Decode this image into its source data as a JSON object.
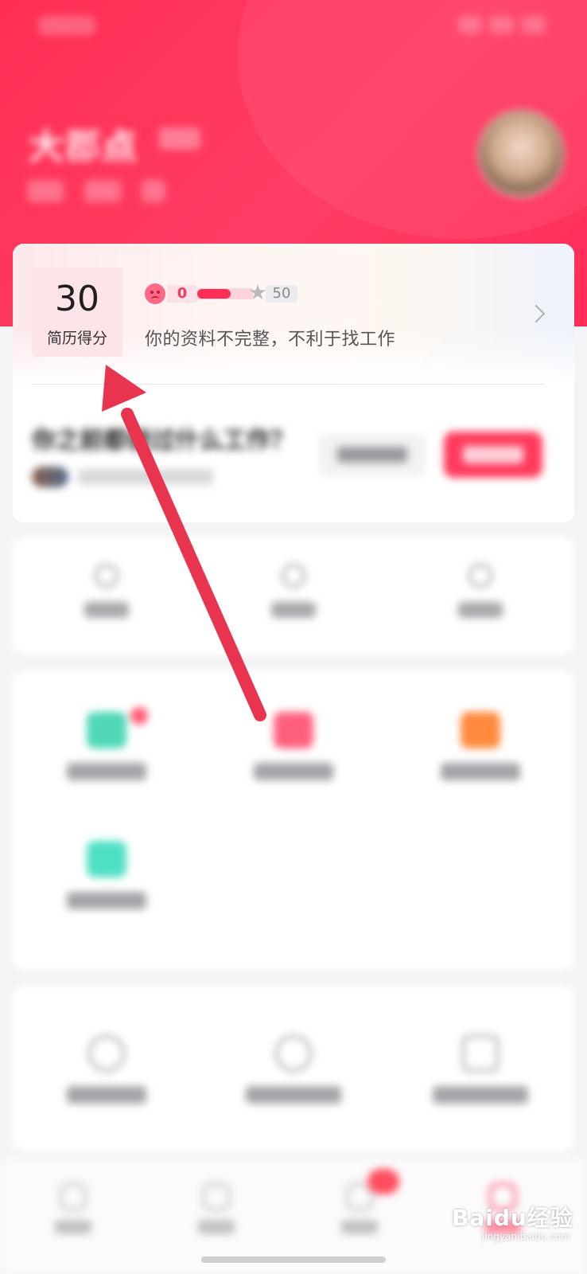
{
  "resume": {
    "score": "30",
    "score_label": "简历得分",
    "progress_min": "0",
    "progress_max": "50",
    "progress_fraction": 0.6,
    "tip": "你的资料不完整，不利于找工作"
  },
  "question": {
    "title": "你之前都做过什么工作？"
  },
  "watermark": {
    "brand": "Baidu经验",
    "url": "jingyan.baidu.com"
  },
  "colors": {
    "accent": "#ff2e55",
    "arrow": "#e8344f"
  }
}
